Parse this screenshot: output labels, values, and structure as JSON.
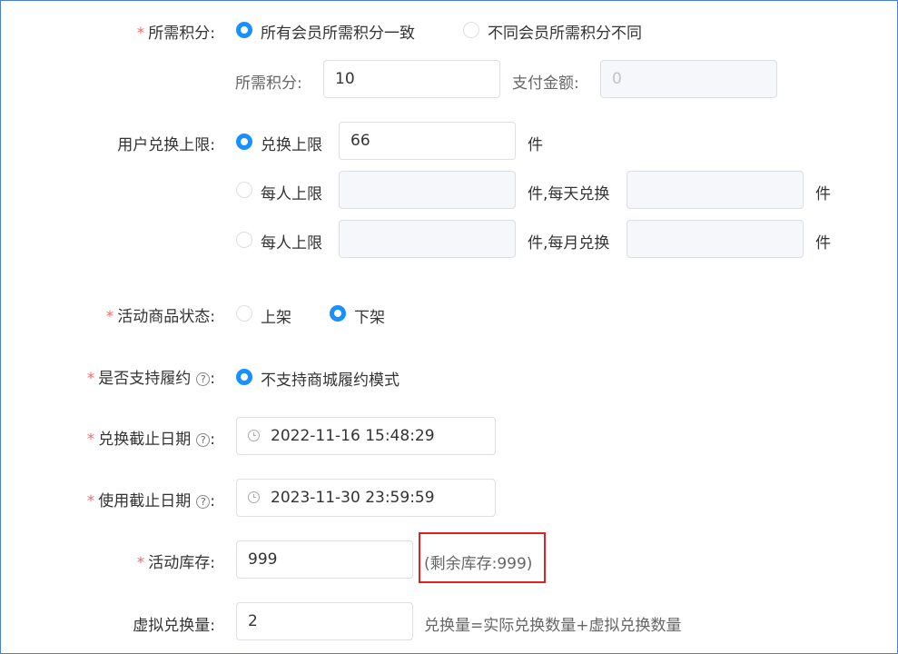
{
  "form": {
    "points": {
      "label": "所需积分:",
      "options": [
        "所有会员所需积分一致",
        "不同会员所需积分不同"
      ],
      "selected": 0,
      "points_label": "所需积分:",
      "points_value": "10",
      "pay_label": "支付金额:",
      "pay_placeholder": "0"
    },
    "limit": {
      "label": "用户兑换上限:",
      "opt1_label": "兑换上限",
      "opt1_value": "66",
      "unit": "件",
      "opt2_label": "每人上限",
      "opt2_mid": "件,每天兑换",
      "opt3_label": "每人上限",
      "opt3_mid": "件,每月兑换"
    },
    "status": {
      "label": "活动商品状态:",
      "options": [
        "上架",
        "下架"
      ],
      "selected": 1
    },
    "fulfill": {
      "label": "是否支持履约",
      "colon": ":",
      "option": "不支持商城履约模式"
    },
    "exchange_deadline": {
      "label": "兑换截止日期",
      "colon": ":",
      "value": "2022-11-16 15:48:29"
    },
    "use_deadline": {
      "label": "使用截止日期",
      "colon": ":",
      "value": "2023-11-30 23:59:59"
    },
    "stock": {
      "label": "活动库存:",
      "value": "999",
      "remaining": "(剩余库存:999)"
    },
    "virtual": {
      "label": "虚拟兑换量:",
      "value": "2",
      "hint": "兑换量=实际兑换数量+虚拟兑换数量"
    }
  },
  "colors": {
    "primary": "#1890ff",
    "required": "#f56c6c",
    "highlight": "#e02020",
    "frame": "#4a7fd6"
  },
  "icons": {
    "help": "question-circle-icon",
    "clock": "clock-icon"
  }
}
